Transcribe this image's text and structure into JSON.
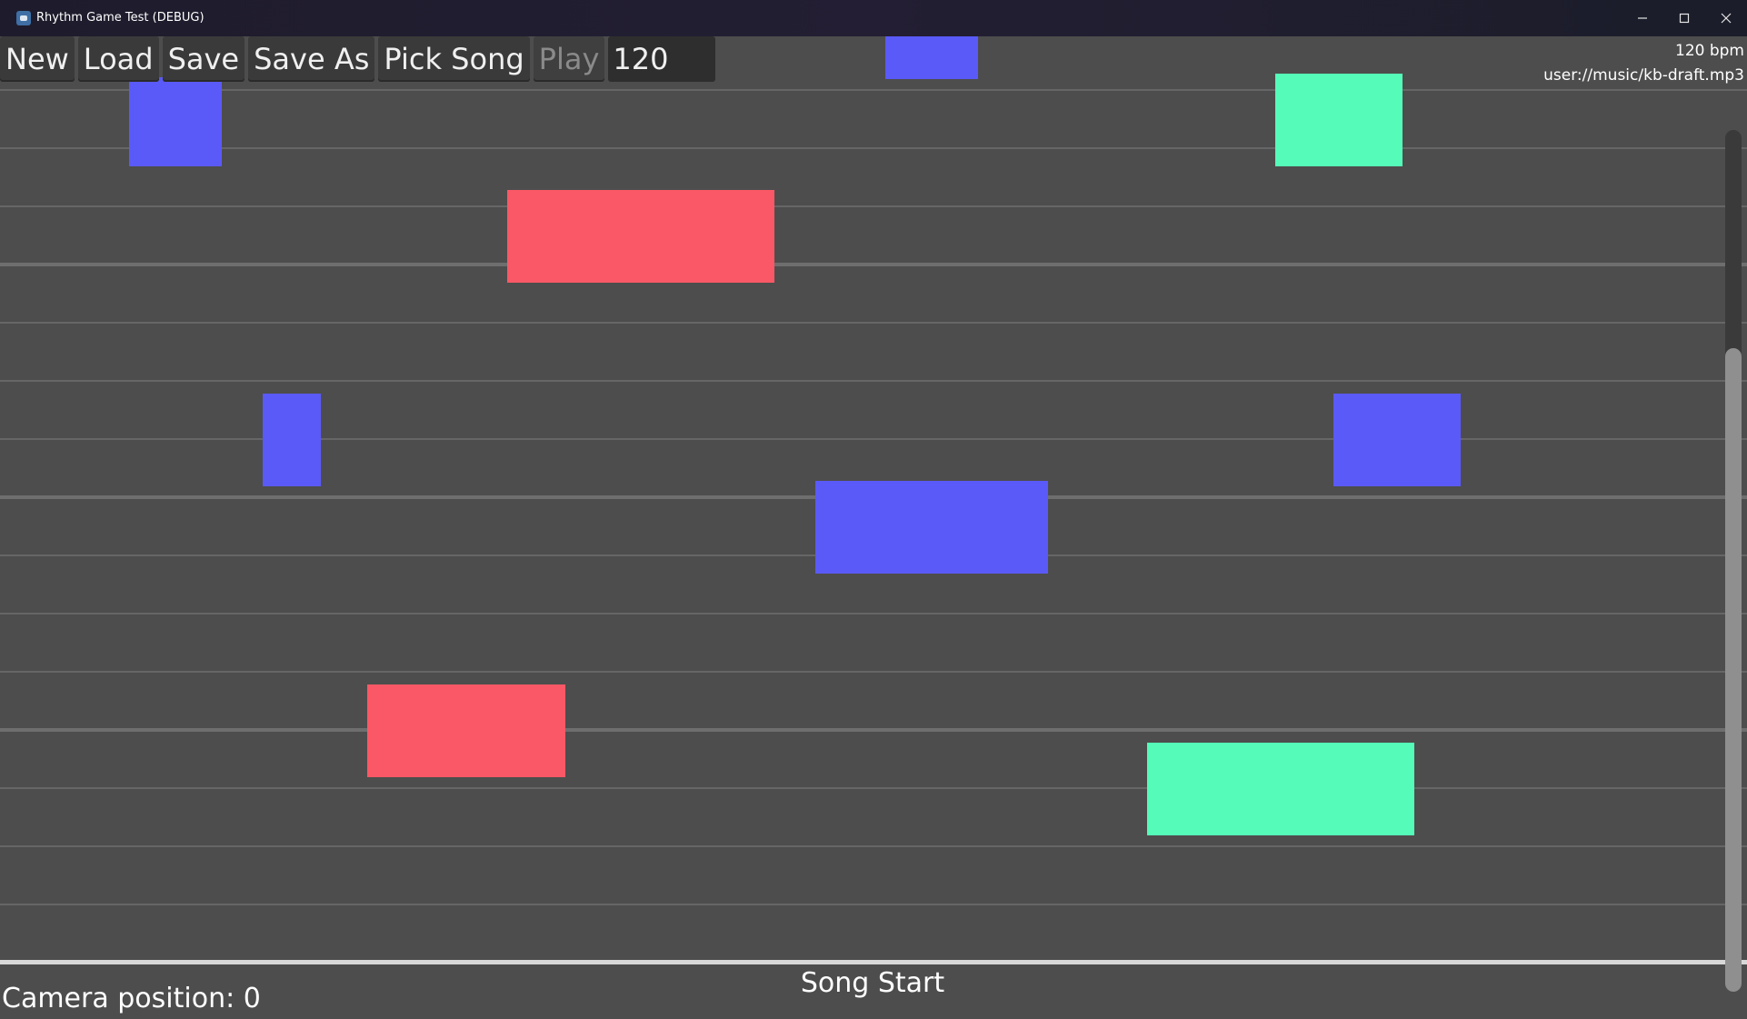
{
  "window": {
    "title": "Rhythm Game Test (DEBUG)",
    "icon": "godot-app-icon",
    "controls": [
      "minimize",
      "maximize",
      "close"
    ]
  },
  "toolbar": {
    "new_label": "New",
    "load_label": "Load",
    "save_label": "Save",
    "save_as_label": "Save As",
    "pick_song_label": "Pick Song",
    "play_label": "Play",
    "bpm_value": "120"
  },
  "info": {
    "bpm_text": "120 bpm",
    "song_path": "user://music/kb-draft.mp3"
  },
  "timeline": {
    "song_start_label": "Song Start",
    "camera_position_text": "Camera position: 0"
  },
  "colors": {
    "background": "#4d4d4d",
    "note_blue": "#5a5af8",
    "note_red": "#fa5866",
    "note_green": "#55fbb8"
  }
}
